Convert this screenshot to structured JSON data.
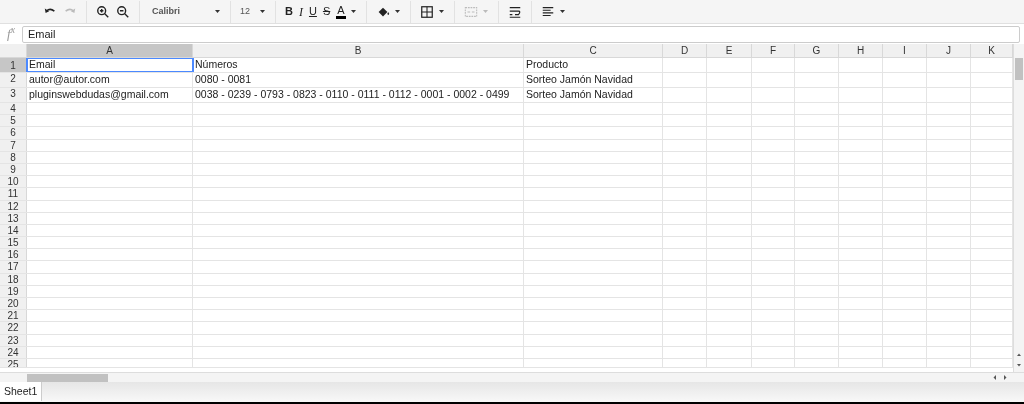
{
  "toolbar": [
    {
      "items": [
        {
          "kind": "undo",
          "disabled": false
        },
        {
          "kind": "redo",
          "disabled": true
        }
      ]
    },
    {
      "items": [
        {
          "kind": "zoom-in",
          "disabled": false
        },
        {
          "kind": "zoom-out",
          "disabled": false
        }
      ]
    },
    {
      "items": [
        {
          "kind": "font",
          "label": "Calibri",
          "disabled": false
        }
      ]
    },
    {
      "items": [
        {
          "kind": "size",
          "label": "12",
          "disabled": false
        }
      ]
    },
    {
      "items": [
        {
          "kind": "bold",
          "label": "B",
          "disabled": false
        },
        {
          "kind": "italic",
          "label": "I",
          "disabled": false
        },
        {
          "kind": "underline",
          "label": "U",
          "disabled": false
        },
        {
          "kind": "strike",
          "label": "S",
          "disabled": false
        },
        {
          "kind": "text-color",
          "label": "A",
          "disabled": false
        }
      ]
    },
    {
      "items": [
        {
          "kind": "fill-color",
          "disabled": false
        }
      ]
    },
    {
      "items": [
        {
          "kind": "borders",
          "disabled": false
        }
      ]
    },
    {
      "items": [
        {
          "kind": "merge",
          "disabled": true
        }
      ]
    },
    {
      "items": [
        {
          "kind": "wrap",
          "disabled": false
        }
      ]
    },
    {
      "items": [
        {
          "kind": "align",
          "disabled": false
        }
      ]
    }
  ],
  "formula_bar": {
    "label": "f$^{x}$",
    "value": "Email"
  },
  "columns": [
    {
      "label": "A",
      "selected": true
    },
    {
      "label": "B",
      "selected": false
    },
    {
      "label": "C",
      "selected": false
    },
    {
      "label": "D",
      "selected": false
    },
    {
      "label": "E",
      "selected": false
    },
    {
      "label": "F",
      "selected": false
    },
    {
      "label": "G",
      "selected": false
    },
    {
      "label": "H",
      "selected": false
    },
    {
      "label": "I",
      "selected": false
    },
    {
      "label": "J",
      "selected": false
    },
    {
      "label": "K",
      "selected": false
    }
  ],
  "rows": [
    {
      "label": "1",
      "selected": true,
      "cells": [
        {
          "text": "Email",
          "selected": true
        },
        {
          "text": "Números",
          "selected": false
        },
        {
          "text": "Producto",
          "selected": false
        }
      ]
    },
    {
      "label": "2",
      "selected": false,
      "cells": [
        {
          "text": "autor@autor.com",
          "selected": false
        },
        {
          "text": "0080 - 0081",
          "selected": false
        },
        {
          "text": "Sorteo Jamón Navidad",
          "selected": false
        }
      ]
    },
    {
      "label": "3",
      "selected": false,
      "cells": [
        {
          "text": "pluginswebdudas@gmail.com",
          "selected": false
        },
        {
          "text": "0038 - 0239 - 0793 - 0823 - 0110 - 0111 - 0112 - 0001 - 0002 - 0499",
          "selected": false
        },
        {
          "text": "Sorteo Jamón Navidad",
          "selected": false
        }
      ]
    },
    {
      "label": "4",
      "selected": false
    },
    {
      "label": "5",
      "selected": false
    },
    {
      "label": "6",
      "selected": false
    },
    {
      "label": "7",
      "selected": false
    },
    {
      "label": "8",
      "selected": false
    },
    {
      "label": "9",
      "selected": false
    },
    {
      "label": "10",
      "selected": false
    },
    {
      "label": "11",
      "selected": false
    },
    {
      "label": "12",
      "selected": false
    },
    {
      "label": "13",
      "selected": false
    },
    {
      "label": "14",
      "selected": false
    },
    {
      "label": "15",
      "selected": false
    },
    {
      "label": "16",
      "selected": false
    },
    {
      "label": "17",
      "selected": false
    },
    {
      "label": "18",
      "selected": false
    },
    {
      "label": "19",
      "selected": false
    },
    {
      "label": "20",
      "selected": false
    },
    {
      "label": "21",
      "selected": false
    },
    {
      "label": "22",
      "selected": false
    },
    {
      "label": "23",
      "selected": false
    },
    {
      "label": "24",
      "selected": false
    },
    {
      "label": "25",
      "selected": false
    }
  ],
  "sheets": [
    {
      "label": "Sheet1",
      "selected": true
    }
  ]
}
